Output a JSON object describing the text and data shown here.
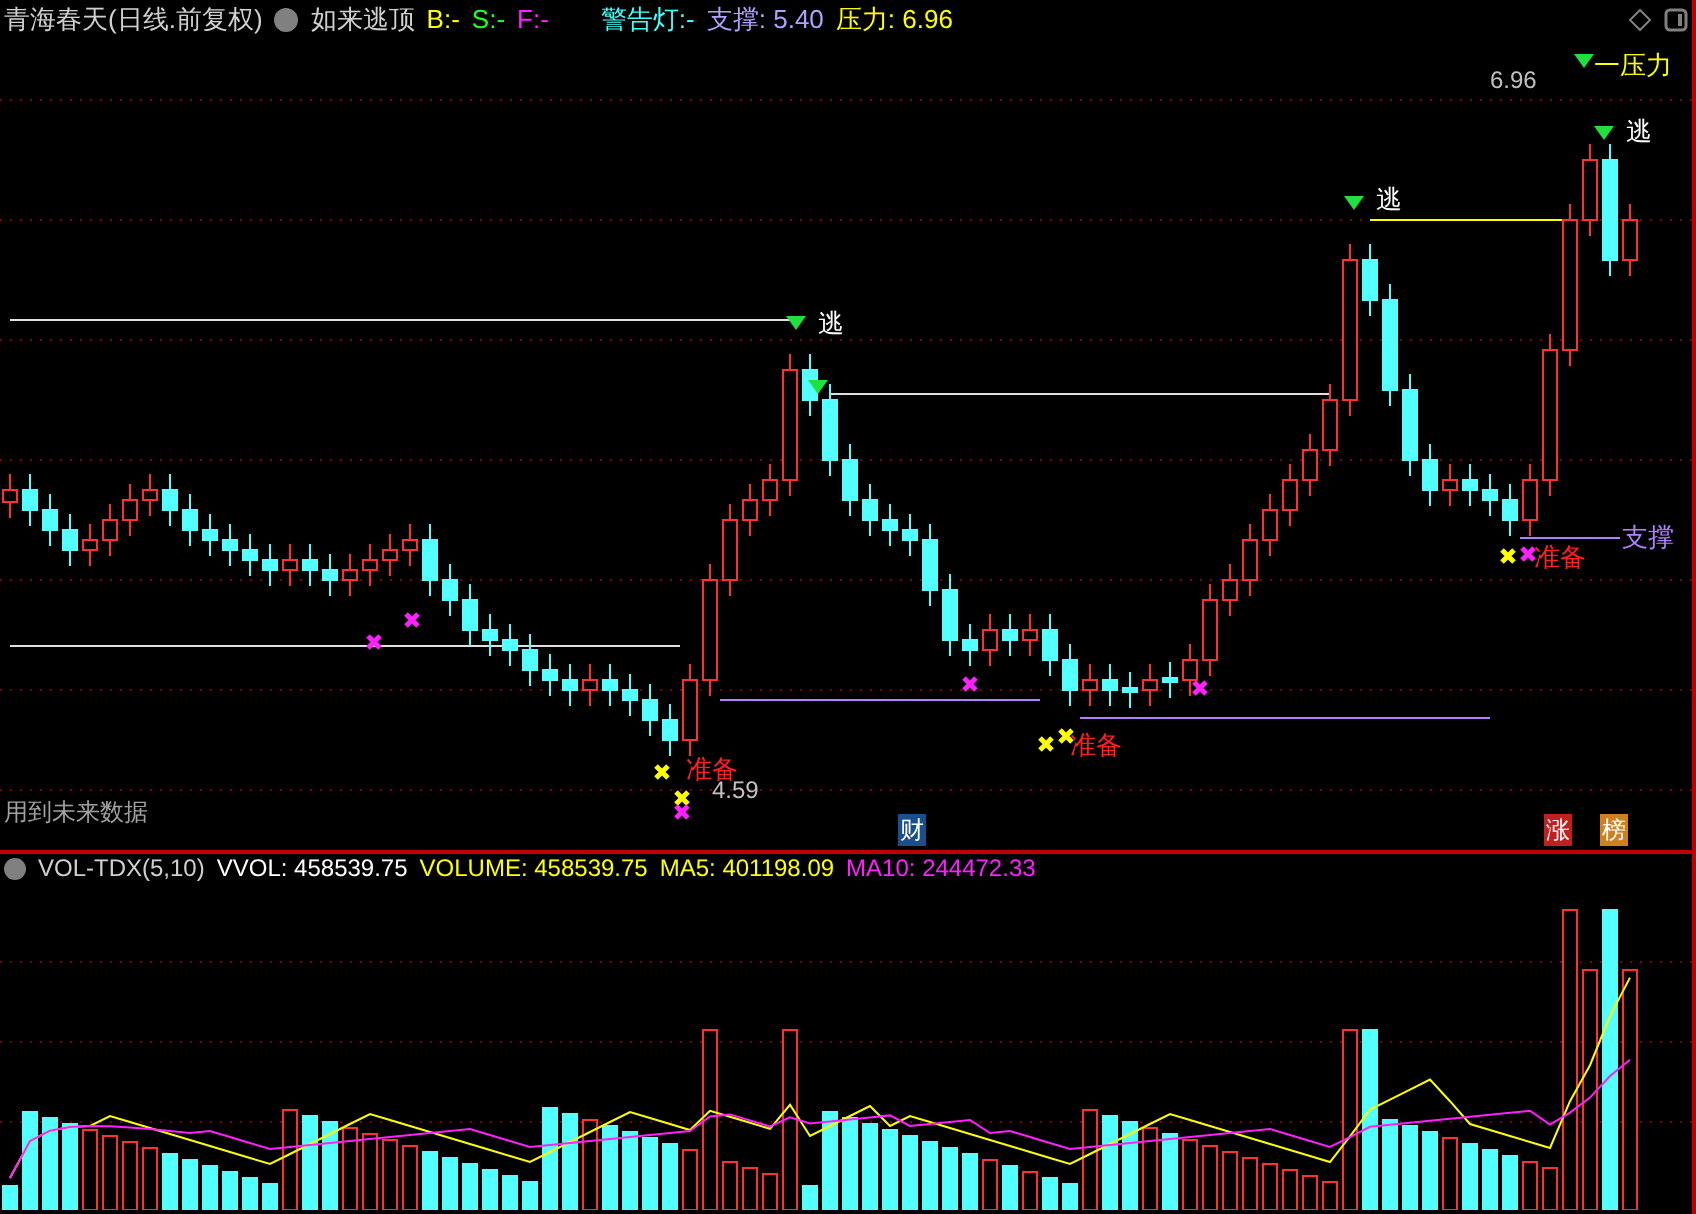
{
  "header": {
    "title": "青海春天(日线.前复权)",
    "indicator": "如来逃顶",
    "b": "B:-",
    "s": "S:-",
    "f": "F:-",
    "warning": "警告灯:-",
    "support": "支撑: 5.40",
    "pressure": "压力: 6.96"
  },
  "annotations": [
    {
      "kind": "pressure",
      "text": "一压力"
    },
    {
      "kind": "price",
      "text": "6.96"
    },
    {
      "kind": "escape",
      "text": "逃"
    },
    {
      "kind": "escape",
      "text": "逃"
    },
    {
      "kind": "escape",
      "text": "逃"
    },
    {
      "kind": "support",
      "text": "支撑"
    },
    {
      "kind": "ready",
      "text": "准备"
    },
    {
      "kind": "ready",
      "text": "准备"
    },
    {
      "kind": "ready",
      "text": "准备"
    },
    {
      "kind": "price",
      "text": "4.59"
    },
    {
      "kind": "note",
      "text": "用到未来数据"
    }
  ],
  "badges": [
    {
      "kind": "finance",
      "text": "财"
    },
    {
      "kind": "rise",
      "text": "涨"
    },
    {
      "kind": "rank",
      "text": "榜"
    }
  ],
  "volume_header": {
    "name": "VOL-TDX(5,10)",
    "vvol": "VVOL: 458539.75",
    "volume": "VOLUME: 458539.75",
    "ma5": "MA5: 401198.09",
    "ma10": "MA10: 244472.33"
  }
}
